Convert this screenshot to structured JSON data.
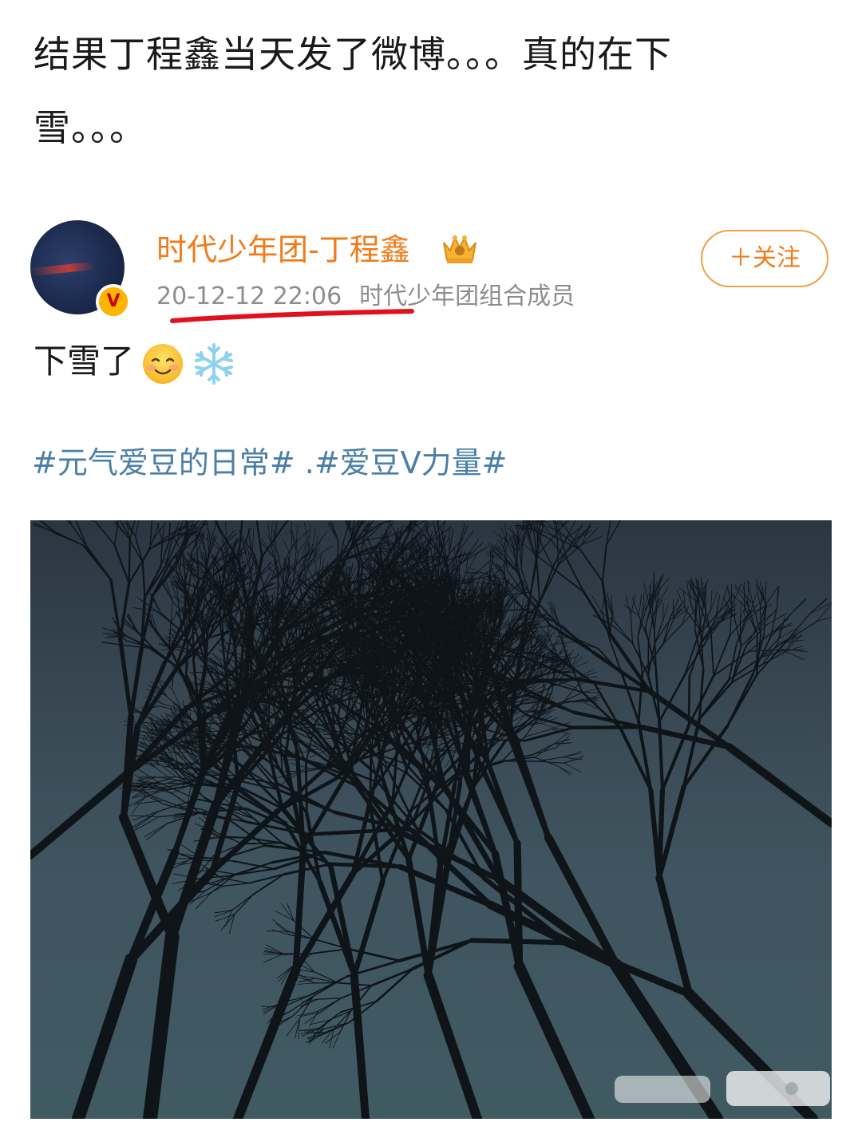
{
  "caption": {
    "line1": "结果丁程鑫当天发了微博。。。真的在下",
    "line2": "雪。。。"
  },
  "post": {
    "author": {
      "name": "时代少年团-丁程鑫",
      "verified_badge": "V",
      "crown_icon": "crown-icon"
    },
    "timestamp": "20-12-12 22:06",
    "source": "时代少年团组合成员",
    "follow_label": "＋关注",
    "text": "下雪了",
    "emojis": [
      "smiling-face-icon",
      "snowflake-icon"
    ],
    "hashtags": "#元气爱豆的日常# .#爱豆V力量#",
    "photo": {
      "subject": "night-sky-bare-trees"
    }
  },
  "colors": {
    "username": "#f07b18",
    "hashtag": "#4a7fa8",
    "meta": "#8d8d8d",
    "underline": "#e0101c"
  }
}
